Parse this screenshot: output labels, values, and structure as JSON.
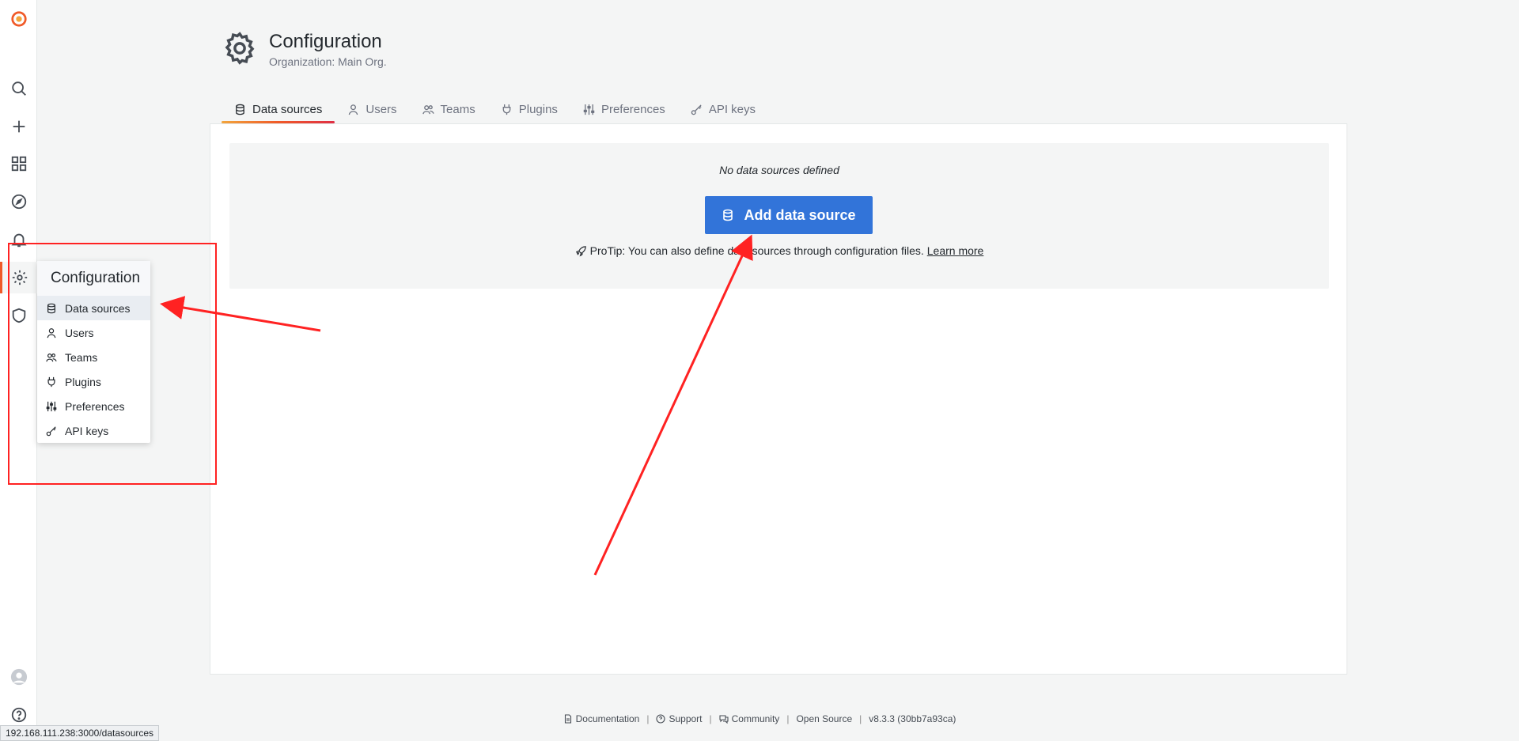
{
  "sidebar": {
    "items": [
      {
        "icon": "grafana-logo-icon"
      },
      {
        "icon": "search-icon"
      },
      {
        "icon": "plus-icon"
      },
      {
        "icon": "dashboards-icon"
      },
      {
        "icon": "explore-compass-icon"
      },
      {
        "icon": "alerting-bell-icon"
      },
      {
        "icon": "gear-icon",
        "active": true
      },
      {
        "icon": "shield-icon"
      },
      {
        "icon": "user-avatar-icon"
      },
      {
        "icon": "help-icon"
      }
    ]
  },
  "flyout": {
    "title": "Configuration",
    "items": [
      {
        "label": "Data sources",
        "icon": "database-icon",
        "active": true
      },
      {
        "label": "Users",
        "icon": "user-icon"
      },
      {
        "label": "Teams",
        "icon": "users-icon"
      },
      {
        "label": "Plugins",
        "icon": "plug-icon"
      },
      {
        "label": "Preferences",
        "icon": "sliders-icon"
      },
      {
        "label": "API keys",
        "icon": "key-icon"
      }
    ]
  },
  "header": {
    "title": "Configuration",
    "subtitle": "Organization: Main Org."
  },
  "tabs": [
    {
      "label": "Data sources",
      "icon": "database-icon",
      "active": true
    },
    {
      "label": "Users",
      "icon": "user-icon"
    },
    {
      "label": "Teams",
      "icon": "users-icon"
    },
    {
      "label": "Plugins",
      "icon": "plug-icon"
    },
    {
      "label": "Preferences",
      "icon": "sliders-icon"
    },
    {
      "label": "API keys",
      "icon": "key-icon"
    }
  ],
  "empty_state": {
    "message": "No data sources defined",
    "button_label": "Add data source",
    "protip": "ProTip: You can also define data sources through configuration files.",
    "learn_more": "Learn more"
  },
  "footer": {
    "documentation": "Documentation",
    "support": "Support",
    "community": "Community",
    "open_source": "Open Source",
    "version": "v8.3.3 (30bb7a93ca)",
    "separator": "|"
  },
  "status_url": "192.168.111.238:3000/datasources",
  "colors": {
    "accent": "#f05a28",
    "primary_button": "#3274d9",
    "annotation": "#ff2222"
  }
}
